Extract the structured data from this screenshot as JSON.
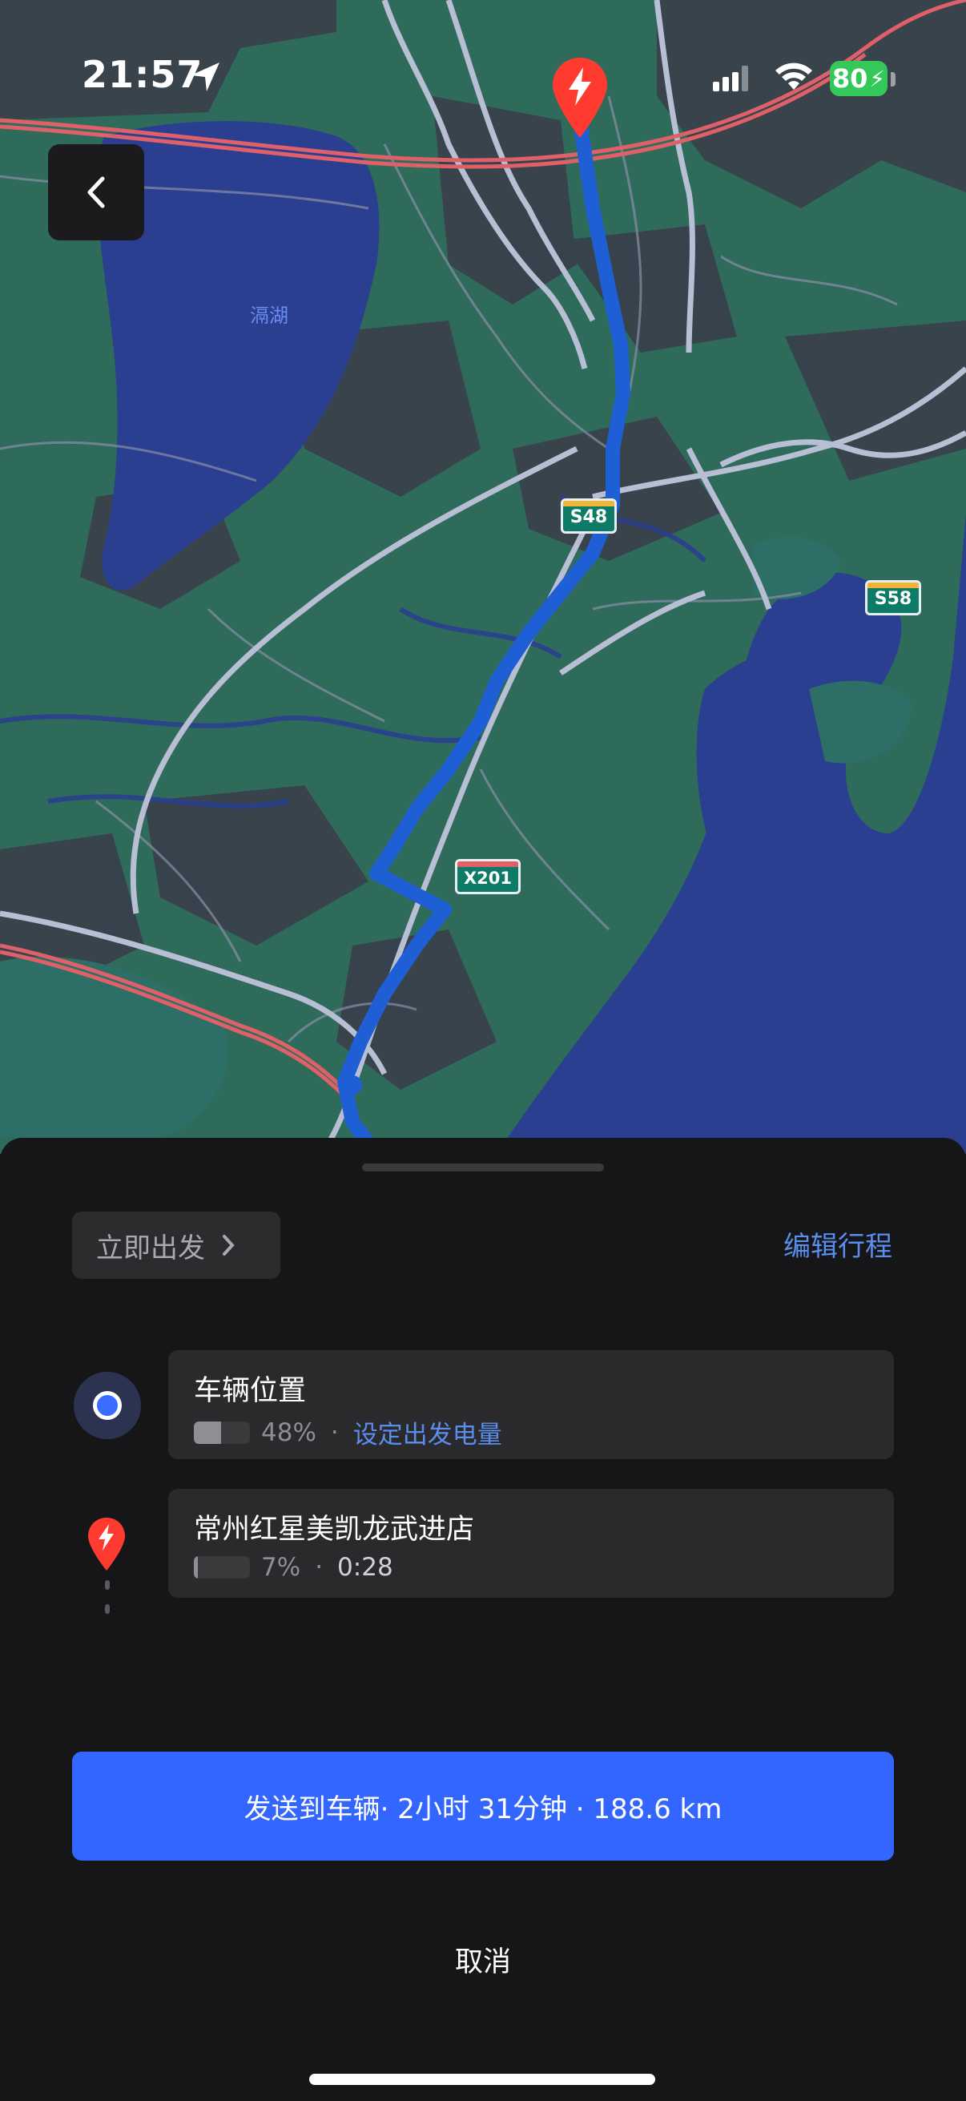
{
  "status_bar": {
    "time": "21:57",
    "battery": "80"
  },
  "map": {
    "lake_label": "滆湖",
    "road_shields": [
      "S48",
      "S58",
      "X201"
    ],
    "colors": {
      "land": "#2f6b5a",
      "water": "#2a3f8f",
      "route": "#1f5fd6",
      "highway": "#e0606a",
      "destination_pin": "#ff3b30"
    }
  },
  "sheet": {
    "depart_label": "立即出发",
    "edit_label": "编辑行程",
    "stops": [
      {
        "name": "车辆位置",
        "battery_pct": "48%",
        "battery_level": 0.48,
        "action": "设定出发电量"
      },
      {
        "name": "常州红星美凯龙武进店",
        "battery_pct": "7%",
        "battery_level": 0.07,
        "eta": "0:28"
      }
    ],
    "dot_separator": "·",
    "send_button": "发送到车辆· 2小时 31分钟 · 188.6 km",
    "cancel_button": "取消"
  }
}
